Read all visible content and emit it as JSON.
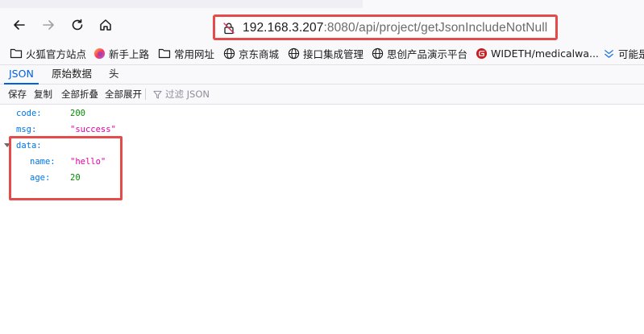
{
  "browser": {
    "url_host": "192.168.3.207",
    "url_rest": ":8080/api/project/getJsonIncludeNotNull"
  },
  "bookmarks": [
    {
      "label": "火狐官方站点",
      "icon": "folder-icon"
    },
    {
      "label": "新手上路",
      "icon": "firefox-icon"
    },
    {
      "label": "常用网址",
      "icon": "folder-icon"
    },
    {
      "label": "京东商城",
      "icon": "globe-icon"
    },
    {
      "label": "接口集成管理",
      "icon": "globe-icon"
    },
    {
      "label": "思创产品演示平台",
      "icon": "globe-icon"
    },
    {
      "label": "WIDETH/medicalwa...",
      "icon": "gitee-icon"
    },
    {
      "label": "可能是",
      "icon": "chevrons-icon"
    }
  ],
  "viewer": {
    "tabs": [
      "JSON",
      "原始数据",
      "头"
    ],
    "toolbar": {
      "save": "保存",
      "copy": "复制",
      "collapse_all": "全部折叠",
      "expand_all": "全部展开",
      "filter_placeholder": "过滤 JSON"
    }
  },
  "json": {
    "code_key": "code:",
    "code_value": "200",
    "msg_key": "msg:",
    "msg_value": "\"success\"",
    "data_key": "data:",
    "name_key": "name:",
    "name_value": "\"hello\"",
    "age_key": "age:",
    "age_value": "20"
  },
  "colors": {
    "highlight": "#e44b4b",
    "accent": "#0060df",
    "key": "#0074e8",
    "number": "#058b00",
    "string": "#dd00a9"
  }
}
